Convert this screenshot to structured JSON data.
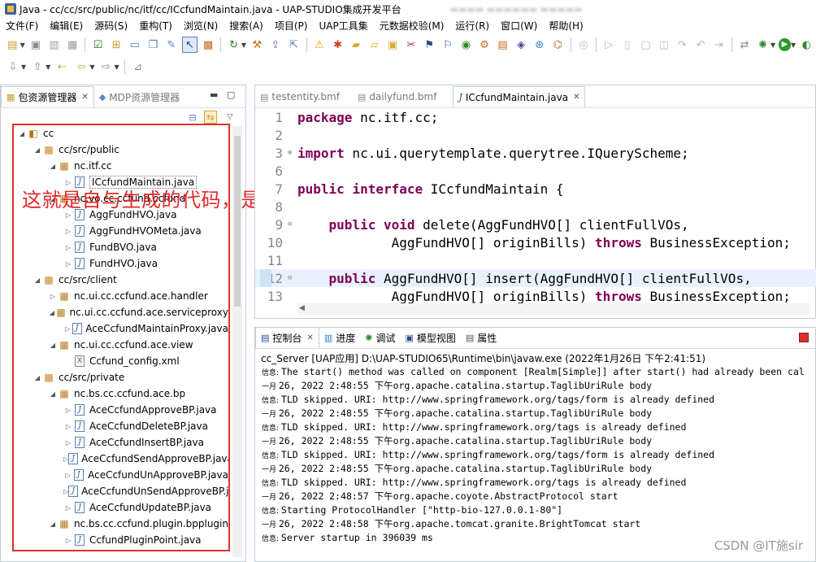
{
  "window": {
    "title": "Java - cc/cc/src/public/nc/itf/cc/ICcfundMaintain.java - UAP-STUDIO集成开发平台"
  },
  "menu": [
    "文件(F)",
    "编辑(E)",
    "源码(S)",
    "重构(T)",
    "浏览(N)",
    "搜索(A)",
    "项目(P)",
    "UAP工具集",
    "元数据校验(M)",
    "运行(R)",
    "窗口(W)",
    "帮助(H)"
  ],
  "left_panel": {
    "tabs": [
      {
        "label": "包资源管理器",
        "close": "✕"
      },
      {
        "label": "MDP资源管理器"
      }
    ],
    "tree": [
      {
        "depth": 0,
        "arrow": "◢",
        "icon": "project",
        "label": "cc"
      },
      {
        "depth": 1,
        "arrow": "◢",
        "icon": "src",
        "label": "cc/src/public"
      },
      {
        "depth": 2,
        "arrow": "◢",
        "icon": "pkg",
        "label": "nc.itf.cc"
      },
      {
        "depth": 3,
        "arrow": "▷",
        "icon": "java",
        "label": "ICcfundMaintain.java",
        "selected": true
      },
      {
        "depth": 2,
        "arrow": "◢",
        "icon": "pkg",
        "label": "nc.vo.cc.ccfund.ccfund"
      },
      {
        "depth": 3,
        "arrow": "▷",
        "icon": "java",
        "label": "AggFundHVO.java"
      },
      {
        "depth": 3,
        "arrow": "▷",
        "icon": "java",
        "label": "AggFundHVOMeta.java"
      },
      {
        "depth": 3,
        "arrow": "▷",
        "icon": "java",
        "label": "FundBVO.java"
      },
      {
        "depth": 3,
        "arrow": "▷",
        "icon": "java",
        "label": "FundHVO.java"
      },
      {
        "depth": 1,
        "arrow": "◢",
        "icon": "src",
        "label": "cc/src/client"
      },
      {
        "depth": 2,
        "arrow": "▷",
        "icon": "pkg",
        "label": "nc.ui.cc.ccfund.ace.handler"
      },
      {
        "depth": 2,
        "arrow": "◢",
        "icon": "pkg",
        "label": "nc.ui.cc.ccfund.ace.serviceproxy"
      },
      {
        "depth": 3,
        "arrow": "▷",
        "icon": "java",
        "label": "AceCcfundMaintainProxy.java"
      },
      {
        "depth": 2,
        "arrow": "◢",
        "icon": "pkg",
        "label": "nc.ui.cc.ccfund.ace.view"
      },
      {
        "depth": 3,
        "arrow": "",
        "icon": "xml",
        "label": "Ccfund_config.xml"
      },
      {
        "depth": 1,
        "arrow": "◢",
        "icon": "src",
        "label": "cc/src/private"
      },
      {
        "depth": 2,
        "arrow": "◢",
        "icon": "pkg",
        "label": "nc.bs.cc.ccfund.ace.bp"
      },
      {
        "depth": 3,
        "arrow": "▷",
        "icon": "java",
        "label": "AceCcfundApproveBP.java"
      },
      {
        "depth": 3,
        "arrow": "▷",
        "icon": "java",
        "label": "AceCcfundDeleteBP.java"
      },
      {
        "depth": 3,
        "arrow": "▷",
        "icon": "java",
        "label": "AceCcfundInsertBP.java"
      },
      {
        "depth": 3,
        "arrow": "▷",
        "icon": "java",
        "label": "AceCcfundSendApproveBP.java"
      },
      {
        "depth": 3,
        "arrow": "▷",
        "icon": "java",
        "label": "AceCcfundUnApproveBP.java"
      },
      {
        "depth": 3,
        "arrow": "▷",
        "icon": "java",
        "label": "AceCcfundUnSendApproveBP.java"
      },
      {
        "depth": 3,
        "arrow": "▷",
        "icon": "java",
        "label": "AceCcfundUpdateBP.java"
      },
      {
        "depth": 2,
        "arrow": "◢",
        "icon": "pkg",
        "label": "nc.bs.cc.ccfund.plugin.bpplugin"
      },
      {
        "depth": 3,
        "arrow": "▷",
        "icon": "java",
        "label": "CcfundPluginPoint.java"
      }
    ]
  },
  "annotation": "这就是自与生成的代码，是不是很快！！！",
  "editor": {
    "tabs": [
      {
        "label": "testentity.bmf"
      },
      {
        "label": "dailyfund.bmf"
      },
      {
        "label": "ICcfundMaintain.java",
        "close": "✕"
      }
    ],
    "lines": [
      {
        "n": "1",
        "fold": "",
        "hl": false,
        "tokens": [
          {
            "k": true,
            "t": "package"
          },
          {
            "k": false,
            "t": " nc.itf.cc;"
          }
        ]
      },
      {
        "n": "2",
        "fold": "",
        "hl": false,
        "tokens": []
      },
      {
        "n": "3",
        "fold": "⊕",
        "hl": false,
        "tokens": [
          {
            "k": true,
            "t": "import"
          },
          {
            "k": false,
            "t": " nc.ui.querytemplate.querytree.IQueryScheme;"
          }
        ]
      },
      {
        "n": "6",
        "fold": "",
        "hl": false,
        "tokens": []
      },
      {
        "n": "7",
        "fold": "",
        "hl": false,
        "tokens": [
          {
            "k": true,
            "t": "public"
          },
          {
            "k": false,
            "t": " "
          },
          {
            "k": true,
            "t": "interface"
          },
          {
            "k": false,
            "t": " ICcfundMaintain {"
          }
        ]
      },
      {
        "n": "8",
        "fold": "",
        "hl": false,
        "tokens": []
      },
      {
        "n": "9",
        "fold": "⊖",
        "hl": false,
        "tokens": [
          {
            "k": false,
            "t": "    "
          },
          {
            "k": true,
            "t": "public"
          },
          {
            "k": false,
            "t": " "
          },
          {
            "k": true,
            "t": "void"
          },
          {
            "k": false,
            "t": " delete(AggFundHVO[] clientFullVOs,"
          }
        ]
      },
      {
        "n": "10",
        "fold": "",
        "hl": false,
        "tokens": [
          {
            "k": false,
            "t": "            AggFundHVO[] originBills) "
          },
          {
            "k": true,
            "t": "throws"
          },
          {
            "k": false,
            "t": " BusinessException;"
          }
        ]
      },
      {
        "n": "11",
        "fold": "",
        "hl": false,
        "tokens": []
      },
      {
        "n": "12",
        "fold": "⊖",
        "hl": true,
        "tokens": [
          {
            "k": false,
            "t": "    "
          },
          {
            "k": true,
            "t": "public"
          },
          {
            "k": false,
            "t": " AggFundHVO[] insert(AggFundHVO[] clientFullVOs,"
          }
        ]
      },
      {
        "n": "13",
        "fold": "",
        "hl": false,
        "tokens": [
          {
            "k": false,
            "t": "            AggFundHVO[] originBills) "
          },
          {
            "k": true,
            "t": "throws"
          },
          {
            "k": false,
            "t": " BusinessException;"
          }
        ]
      }
    ]
  },
  "console": {
    "tabs": [
      {
        "label": "控制台",
        "close": "✕"
      },
      {
        "label": "进度"
      },
      {
        "label": "调试"
      },
      {
        "label": "模型视图"
      },
      {
        "label": "属性"
      }
    ],
    "title": "cc_Server [UAP应用] D:\\UAP-STUDIO65\\Runtime\\bin\\javaw.exe (2022年1月26日 下午2:41:51)",
    "lines": [
      {
        "prefix": "信息: ",
        "text": "The start() method was called on component [Realm[Simple]] after start() had already been cal"
      },
      {
        "prefix": "一月 ",
        "text": "26, 2022 2:48:55 下午org.apache.catalina.startup.TaglibUriRule body"
      },
      {
        "prefix": "信息: ",
        "text": "TLD skipped. URI: http://www.springframework.org/tags/form is already defined"
      },
      {
        "prefix": "一月 ",
        "text": "26, 2022 2:48:55 下午org.apache.catalina.startup.TaglibUriRule body"
      },
      {
        "prefix": "信息: ",
        "text": "TLD skipped. URI: http://www.springframework.org/tags is already defined"
      },
      {
        "prefix": "一月 ",
        "text": "26, 2022 2:48:55 下午org.apache.catalina.startup.TaglibUriRule body"
      },
      {
        "prefix": "信息: ",
        "text": "TLD skipped. URI: http://www.springframework.org/tags/form is already defined"
      },
      {
        "prefix": "一月 ",
        "text": "26, 2022 2:48:55 下午org.apache.catalina.startup.TaglibUriRule body"
      },
      {
        "prefix": "信息: ",
        "text": "TLD skipped. URI: http://www.springframework.org/tags is already defined"
      },
      {
        "prefix": "一月 ",
        "text": "26, 2022 2:48:57 下午org.apache.coyote.AbstractProtocol start"
      },
      {
        "prefix": "信息: ",
        "text": "Starting ProtocolHandler [\"http-bio-127.0.0.1-80\"]"
      },
      {
        "prefix": "一月 ",
        "text": "26, 2022 2:48:58 下午org.apache.tomcat.granite.BrightTomcat start"
      },
      {
        "prefix": "信息: ",
        "text": "Server startup in 396039 ms"
      }
    ]
  },
  "watermark": "CSDN @IT施sir"
}
